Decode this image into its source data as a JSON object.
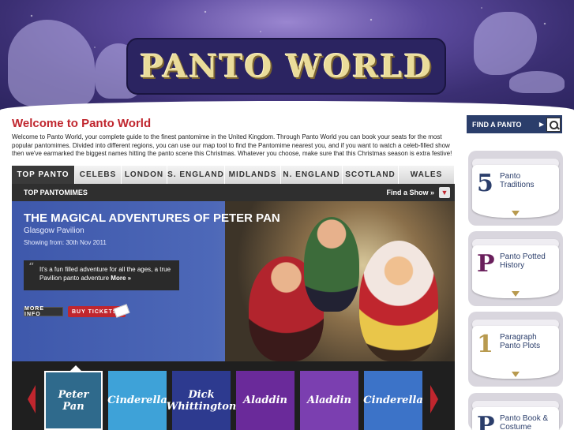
{
  "header": {
    "logo_text": "PANTO WORLD"
  },
  "welcome": {
    "title": "Welcome to Panto World",
    "text": "Welcome to Panto World, your complete guide to the finest pantomime in the United Kingdom. Through Panto World you can book your seats for the most popular pantomimes. Divided into different regions, you can use our map tool to find the Pantomime nearest you, and if you want to watch a celeb-filled show then we've earmarked the biggest names hitting the panto scene this Christmas. Whatever you choose, make sure that this Christmas season is extra festive!"
  },
  "tabs": [
    {
      "label": "TOP PANTO"
    },
    {
      "label": "CELEBS"
    },
    {
      "label": "LONDON"
    },
    {
      "label": "S. ENGLAND"
    },
    {
      "label": "MIDLANDS"
    },
    {
      "label": "N. ENGLAND"
    },
    {
      "label": "SCOTLAND"
    },
    {
      "label": "WALES"
    }
  ],
  "subbar": {
    "title": "TOP PANTOMIMES",
    "find_show": "Find a Show »",
    "find_show_icon": "chevron-down-icon"
  },
  "hero": {
    "title": "THE MAGICAL ADVENTURES OF PETER PAN",
    "venue": "Glasgow Pavilion",
    "date": "Showing from: 30th Nov 2011",
    "quote": "It's a fun filled adventure for all the ages, a true Pavilion panto adventure",
    "quote_more": "More »",
    "more_info": "MORE INFO",
    "buy_tickets": "BUY TICKETS"
  },
  "carousel": {
    "items": [
      {
        "title": "Peter Pan",
        "color": "#2f6a8c"
      },
      {
        "title": "Cinderella",
        "color": "#3ea2d8"
      },
      {
        "title": "Dick Whittington",
        "color": "#2d3a8f"
      },
      {
        "title": "Aladdin",
        "color": "#6a2a9a"
      },
      {
        "title": "Aladdin",
        "color": "#7b3fb0"
      },
      {
        "title": "Cinderella",
        "color": "#3c73c8"
      }
    ]
  },
  "sidebar": {
    "find_panto": "FIND A PANTO",
    "cards": [
      {
        "icon_char": "5",
        "icon_color": "#2b3e6b",
        "label": "Panto Traditions"
      },
      {
        "icon_char": "P",
        "icon_color": "#6a1f5c",
        "label": "Panto Potted History"
      },
      {
        "icon_char": "1",
        "icon_color": "#b89a4f",
        "label": "Paragraph Panto Plots"
      },
      {
        "icon_char": "P",
        "icon_color": "#2b3e6b",
        "label": "Panto Book & Costume"
      }
    ]
  },
  "colors": {
    "brand_red": "#c0262e",
    "navy": "#2b3e6b",
    "gold": "#b89a4f"
  }
}
